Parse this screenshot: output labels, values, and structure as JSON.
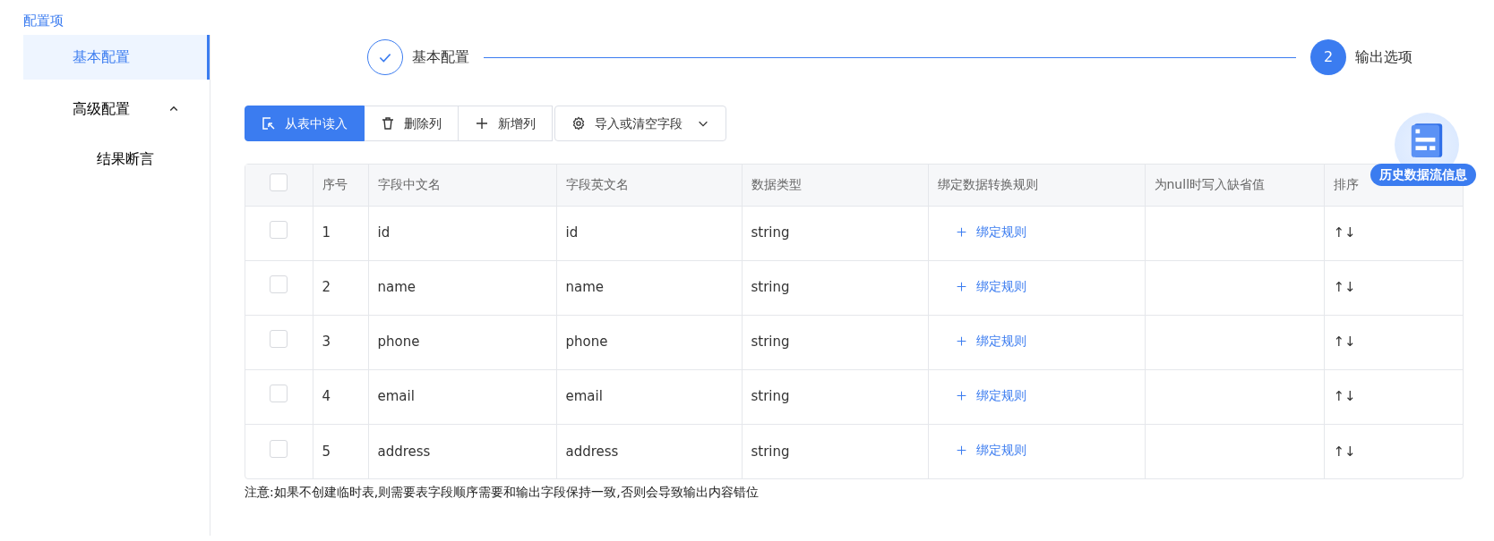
{
  "sidebar": {
    "title": "配置项",
    "items": [
      {
        "label": "基本配置",
        "selected": true
      },
      {
        "label": "高级配置",
        "selected": false,
        "expanded": true,
        "children": [
          {
            "label": "结果断言",
            "selected": false
          }
        ]
      }
    ]
  },
  "steps": [
    {
      "label": "基本配置",
      "done": true
    },
    {
      "number": "2",
      "label": "输出选项",
      "done": false
    }
  ],
  "toolbar": [
    {
      "label": "从表中读入",
      "kind": "read",
      "primary": true
    },
    {
      "label": "删除列",
      "kind": "delete",
      "primary": false
    },
    {
      "label": "新增列",
      "kind": "add",
      "primary": false
    },
    {
      "label": "导入或清空字段",
      "kind": "settings",
      "primary": false,
      "dropdown": true
    }
  ],
  "table": {
    "select_all_checked": false,
    "columns": [
      "序号",
      "字段中文名",
      "字段英文名",
      "数据类型",
      "绑定数据转换规则",
      "为null时写入缺省值",
      "排序"
    ],
    "rows": [
      {
        "checked": false,
        "index": "1",
        "cn_name": "id",
        "en_name": "id",
        "type": "string",
        "rule": "绑定规则",
        "sort": "↑↓"
      },
      {
        "checked": false,
        "index": "2",
        "cn_name": "name",
        "en_name": "name",
        "type": "string",
        "rule": "绑定规则",
        "sort": "↑↓"
      },
      {
        "checked": false,
        "index": "3",
        "cn_name": "phone",
        "en_name": "phone",
        "type": "string",
        "rule": "绑定规则",
        "sort": "↑↓"
      },
      {
        "checked": false,
        "index": "4",
        "cn_name": "email",
        "en_name": "email",
        "type": "string",
        "rule": "绑定规则",
        "sort": "↑↓"
      },
      {
        "checked": false,
        "index": "5",
        "cn_name": "address",
        "en_name": "address",
        "type": "string",
        "rule": "绑定规则",
        "sort": "↑↓"
      }
    ]
  },
  "note": "注意:如果不创建临时表,则需要表字段顺序需要和输出字段保持一致,否则会导致输出内容错位",
  "history_widget": {
    "label": "历史数据流信息"
  }
}
